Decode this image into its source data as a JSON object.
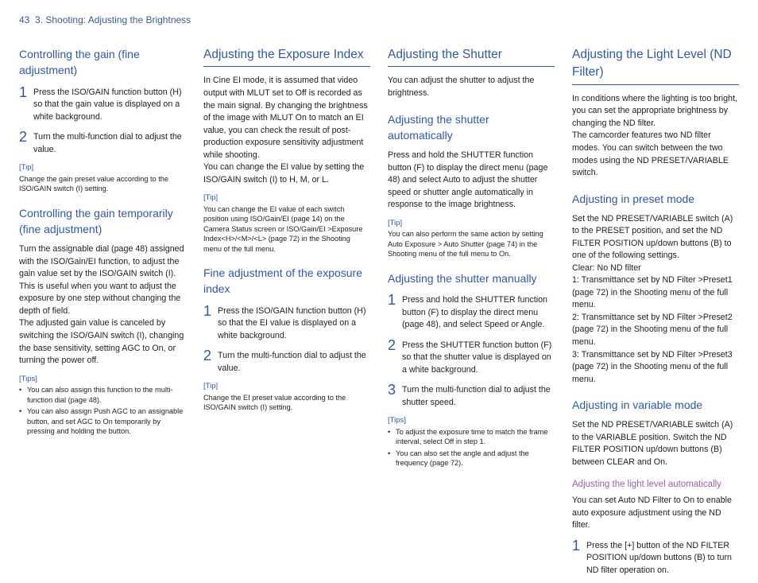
{
  "header": {
    "pageNumber": "43",
    "breadcrumb": "3. Shooting: Adjusting the Brightness"
  },
  "col1": {
    "h2a": "Controlling the gain (fine adjustment)",
    "stepsA": [
      "Press the ISO/GAIN function button (H) so that the gain value is displayed on a white background.",
      "Turn the multi-function dial to adjust the value."
    ],
    "tipLblA": "[Tip]",
    "tipA": "Change the gain preset value according to the ISO/GAIN switch (I) setting.",
    "h2b": "Controlling the gain temporarily (fine adjustment)",
    "pB": "Turn the assignable dial (page 48) assigned with the ISO/Gain/EI function, to adjust the gain value set by the ISO/GAIN switch (I). This is useful when you want to adjust the exposure by one step without changing the depth of field.\nThe adjusted gain value is canceled by switching the ISO/GAIN switch (I), changing the base sensitivity, setting AGC to On, or turning the power off.",
    "tipsLblB": "[Tips]",
    "tipsB": [
      "You can also assign this function to the multi-function dial (page 48).",
      "You can also assign Push AGC to an assignable button, and set AGC to On temporarily by pressing and holding the button."
    ]
  },
  "col2": {
    "h1": "Adjusting the Exposure Index",
    "p1": "In Cine EI mode, it is assumed that video output with MLUT set to Off is recorded as the main signal. By changing the brightness of the image with MLUT On to match an EI value, you can check the result of post-production exposure sensitivity adjustment while shooting.\nYou can change the EI value by setting the ISO/GAIN switch (I) to H, M, or L.",
    "tipLbl1": "[Tip]",
    "tip1": "You can change the EI value of each switch position using ISO/Gain/EI (page 14) on the Camera Status screen or ISO/Gain/EI >Exposure Index<H>/<M>/<L> (page 72) in the Shooting menu of the full menu.",
    "h2": "Fine adjustment of the exposure index",
    "steps": [
      "Press the ISO/GAIN function button (H) so that the EI value is displayed on a white background.",
      "Turn the multi-function dial to adjust the value."
    ],
    "tipLbl2": "[Tip]",
    "tip2": "Change the EI preset value according to the ISO/GAIN switch (I) setting."
  },
  "col3": {
    "h1": "Adjusting the Shutter",
    "p1": "You can adjust the shutter to adjust the brightness.",
    "h2a": "Adjusting the shutter automatically",
    "pA": "Press and hold the SHUTTER function button (F) to display the direct menu (page 48) and select Auto to adjust the shutter speed or shutter angle automatically in response to the image brightness.",
    "tipLblA": "[Tip]",
    "tipA": "You can also perform the same action by setting Auto Exposure > Auto Shutter (page 74) in the Shooting menu of the full menu to On.",
    "h2b": "Adjusting the shutter manually",
    "stepsB": [
      "Press and hold the SHUTTER function button (F) to display the direct menu (page 48), and select Speed or Angle.",
      "Press the SHUTTER function button (F) so that the shutter value is displayed on a white background.",
      "Turn the multi-function dial to adjust the shutter speed."
    ],
    "tipsLblB": "[Tips]",
    "tipsB": [
      "To adjust the exposure time to match the frame interval, select Off in step 1.",
      "You can also set the angle and adjust the frequency (page 72)."
    ]
  },
  "col4": {
    "h1": "Adjusting the Light Level (ND Filter)",
    "p1": "In conditions where the lighting is too bright, you can set the appropriate brightness by changing the ND filter.\nThe camcorder features two ND filter modes. You can switch between the two modes using the ND PRESET/VARIABLE switch.",
    "h2a": "Adjusting in preset mode",
    "pA": "Set the ND PRESET/VARIABLE switch (A) to the PRESET position, and set the ND FILTER POSITION up/down buttons (B) to one of the following settings.\nClear: No ND filter\n1: Transmittance set by ND Filter >Preset1 (page 72) in the Shooting menu of the full menu.\n2: Transmittance set by ND Filter >Preset2 (page 72) in the Shooting menu of the full menu.\n3: Transmittance set by ND Filter >Preset3 (page 72) in the Shooting menu of the full menu.",
    "h2b": "Adjusting in variable mode",
    "pB": "Set the ND PRESET/VARIABLE switch (A) to the VARIABLE position. Switch the ND FILTER POSITION up/down buttons (B) between CLEAR and On.",
    "h3": "Adjusting the light level automatically",
    "pC": "You can set Auto ND Filter to On to enable auto exposure adjustment using the ND filter.",
    "stepsC": [
      "Press the [+] button of the ND FILTER POSITION up/down buttons (B) to turn ND filter operation on."
    ]
  }
}
